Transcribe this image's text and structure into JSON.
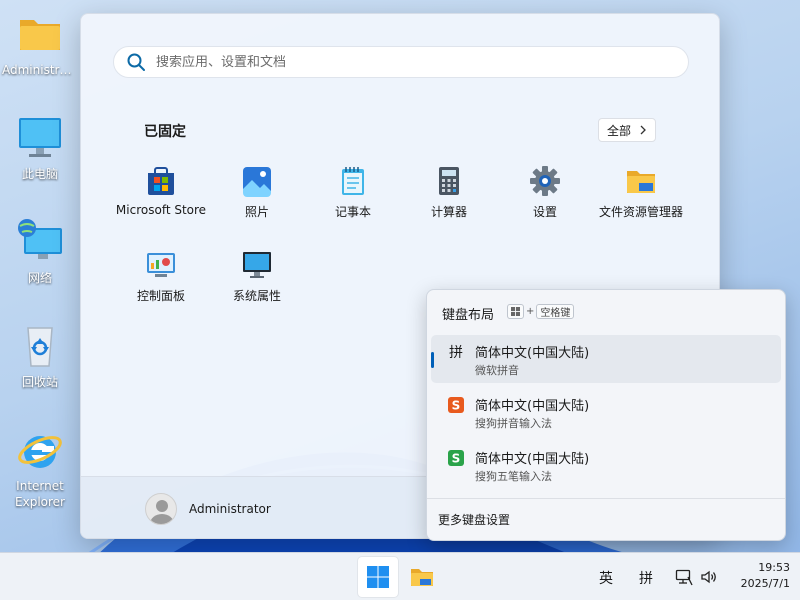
{
  "desktop": {
    "icons": [
      {
        "label": "Administra..."
      },
      {
        "label": "此电脑"
      },
      {
        "label": "网络"
      },
      {
        "label": "回收站"
      },
      {
        "label": "Internet Explorer"
      }
    ]
  },
  "start_menu": {
    "search": {
      "placeholder": "搜索应用、设置和文档"
    },
    "pinned_title": "已固定",
    "all_button": "全部",
    "apps": [
      {
        "label": "Microsoft Store",
        "icon": "store-icon"
      },
      {
        "label": "照片",
        "icon": "photos-icon"
      },
      {
        "label": "记事本",
        "icon": "notepad-icon"
      },
      {
        "label": "计算器",
        "icon": "calculator-icon"
      },
      {
        "label": "设置",
        "icon": "gear-icon"
      },
      {
        "label": "文件资源管理器",
        "icon": "folder-icon"
      },
      {
        "label": "控制面板",
        "icon": "control-panel-icon"
      },
      {
        "label": "系统属性",
        "icon": "monitor-icon"
      }
    ],
    "user": {
      "name": "Administrator"
    }
  },
  "keyboard_flyout": {
    "title": "键盘布局",
    "shortcut_plus": "+",
    "shortcut_key": "空格键",
    "items": [
      {
        "glyph": "拼",
        "name": "简体中文(中国大陆)",
        "ime": "微软拼音",
        "selected": true
      },
      {
        "glyph": "S",
        "name": "简体中文(中国大陆)",
        "ime": "搜狗拼音输入法",
        "selected": false,
        "color": "#e85a1e"
      },
      {
        "glyph": "S",
        "name": "简体中文(中国大陆)",
        "ime": "搜狗五笔输入法",
        "selected": false,
        "color": "#2aa34a"
      }
    ],
    "more": "更多键盘设置"
  },
  "taskbar": {
    "lang": "英",
    "ime": "拼",
    "time": "19:53",
    "date": "2025/7/1"
  },
  "colors": {
    "accent": "#005fb8",
    "sogou_pinyin": "#e85a1e",
    "sogou_wubi": "#2aa34a"
  }
}
